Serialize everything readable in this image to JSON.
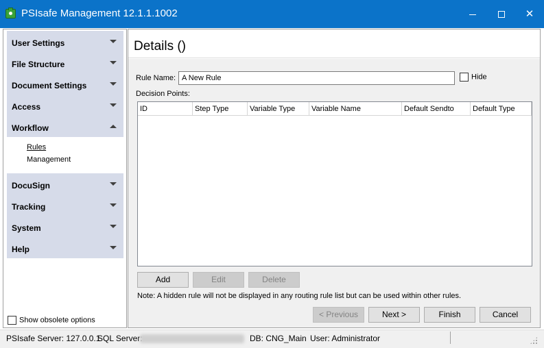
{
  "window": {
    "title": "PSIsafe Management 12.1.1.1002"
  },
  "sidebar": {
    "items": [
      {
        "label": "User Settings",
        "expanded": false
      },
      {
        "label": "File Structure",
        "expanded": false
      },
      {
        "label": "Document Settings",
        "expanded": false
      },
      {
        "label": "Access",
        "expanded": false
      },
      {
        "label": "Workflow",
        "expanded": true
      },
      {
        "label": "DocuSign",
        "expanded": false
      },
      {
        "label": "Tracking",
        "expanded": false
      },
      {
        "label": "System",
        "expanded": false
      },
      {
        "label": "Help",
        "expanded": false
      }
    ],
    "workflow_subitems": [
      {
        "label": "Rules",
        "active": true
      },
      {
        "label": "Management",
        "active": false
      }
    ],
    "show_obsolete_label": "Show obsolete options",
    "show_obsolete_checked": false
  },
  "details": {
    "title": "Details ()",
    "rule_name_label": "Rule Name:",
    "rule_name_value": "A New Rule",
    "hide_label": "Hide",
    "hide_checked": false,
    "decision_points_label": "Decision Points:",
    "columns": [
      "ID",
      "Step Type",
      "Variable Type",
      "Variable Name",
      "Default Sendto",
      "Default Type"
    ],
    "rows": [],
    "buttons": {
      "add": "Add",
      "edit": "Edit",
      "delete": "Delete"
    },
    "note": "Note: A hidden rule will not be displayed in any routing rule list but can be used within other rules.",
    "nav_buttons": {
      "previous": "< Previous",
      "next": "Next >",
      "finish": "Finish",
      "cancel": "Cancel"
    }
  },
  "statusbar": {
    "server": "PSIsafe Server: 127.0.0.1",
    "sql_label": "SQL Server:",
    "db": "DB: CNG_Main",
    "user": "User: Administrator"
  }
}
